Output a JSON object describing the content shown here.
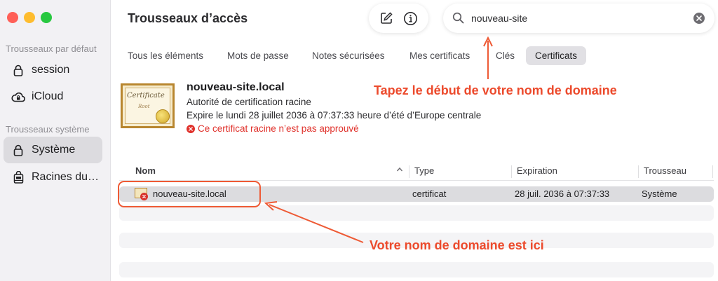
{
  "window": {
    "title": "Trousseaux d’accès"
  },
  "sidebar": {
    "section_default": "Trousseaux par défaut",
    "section_system": "Trousseaux système",
    "items": [
      {
        "label": "session",
        "icon": "lock-icon"
      },
      {
        "label": "iCloud",
        "icon": "cloud-lock-icon"
      },
      {
        "label": "Système",
        "icon": "lock-icon",
        "active": true
      },
      {
        "label": "Racines du…",
        "icon": "cabinet-lock-icon"
      }
    ]
  },
  "toolbar": {
    "compose_icon": "compose-icon",
    "info_icon": "info-icon"
  },
  "search": {
    "value": "nouveau-site",
    "icon": "search-icon"
  },
  "tabs": [
    {
      "label": "Tous les éléments"
    },
    {
      "label": "Mots de passe"
    },
    {
      "label": "Notes sécurisées"
    },
    {
      "label": "Mes certificats"
    },
    {
      "label": "Clés"
    },
    {
      "label": "Certificats",
      "active": true
    }
  ],
  "detail": {
    "image_text": "Certificate",
    "image_subtext": "Root",
    "name": "nouveau-site.local",
    "kind": "Autorité de certification racine",
    "expires": "Expire le lundi 28 juillet 2036 à 07:37:33 heure d’été d’Europe centrale",
    "warning": "Ce certificat racine n’est pas approuvé"
  },
  "table": {
    "columns": [
      "Nom",
      "Type",
      "Expiration",
      "Trousseau"
    ],
    "rows": [
      {
        "name": "nouveau-site.local",
        "type": "certificat",
        "expiration": "28 juil. 2036 à 07:37:33",
        "keychain": "Système"
      }
    ]
  },
  "annotations": {
    "search_hint": "Tapez le début de votre nom de domaine",
    "row_hint": "Votre nom de domaine est ici"
  },
  "colors": {
    "accent": "#ec4a2c",
    "warning": "#e0322c",
    "selection": "#dcdcdf"
  }
}
